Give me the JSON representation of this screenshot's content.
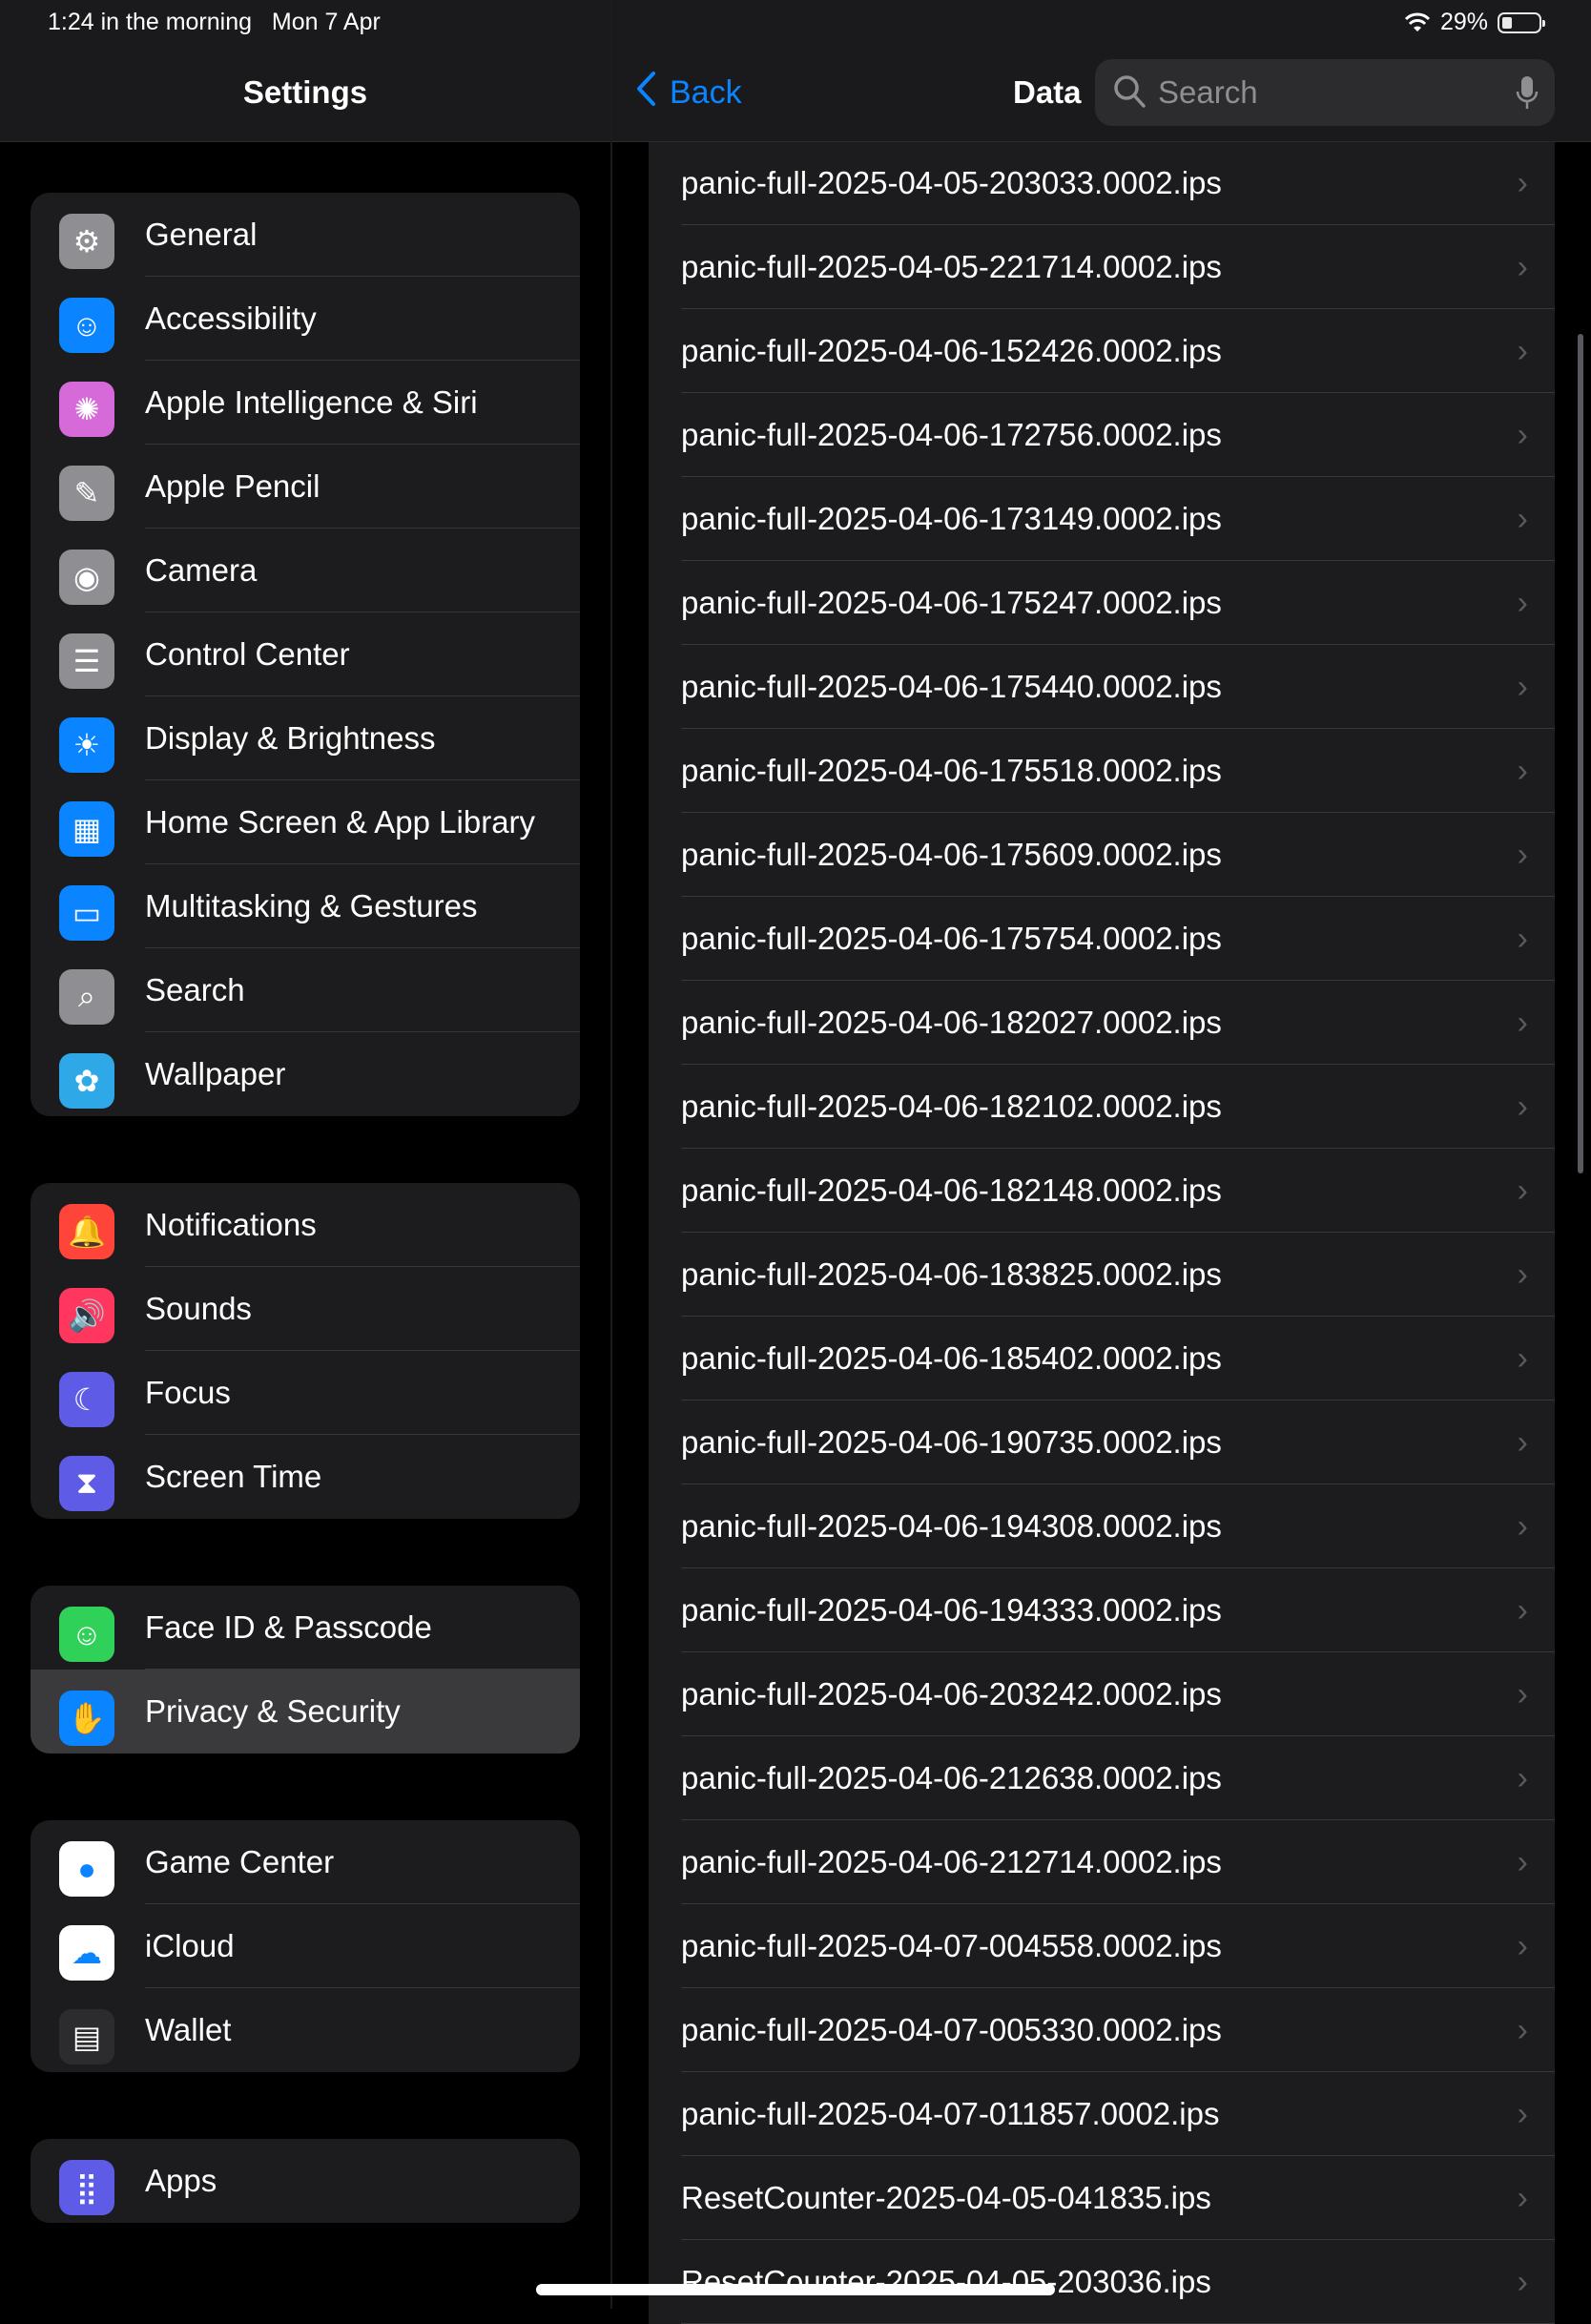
{
  "status_bar": {
    "time": "1:24 in the morning",
    "date": "Mon 7 Apr",
    "battery": "29%",
    "battery_level": 0.29
  },
  "sidebar": {
    "title": "Settings",
    "groups": [
      {
        "items": [
          {
            "label": "General",
            "icon": "gear-icon",
            "color": "#8e8e93"
          },
          {
            "label": "Accessibility",
            "icon": "accessibility-icon",
            "color": "#0a84ff"
          },
          {
            "label": "Apple Intelligence & Siri",
            "icon": "apple-intelligence-icon",
            "color": "#d66ad9"
          },
          {
            "label": "Apple Pencil",
            "icon": "pencil-icon",
            "color": "#8e8e93"
          },
          {
            "label": "Camera",
            "icon": "camera-icon",
            "color": "#8e8e93"
          },
          {
            "label": "Control Center",
            "icon": "toggles-icon",
            "color": "#8e8e93"
          },
          {
            "label": "Display & Brightness",
            "icon": "sun-icon",
            "color": "#0a84ff"
          },
          {
            "label": "Home Screen & App Library",
            "icon": "home-screen-icon",
            "color": "#0a84ff"
          },
          {
            "label": "Multitasking & Gestures",
            "icon": "multitasking-icon",
            "color": "#0a84ff"
          },
          {
            "label": "Search",
            "icon": "search-icon",
            "color": "#8e8e93"
          },
          {
            "label": "Wallpaper",
            "icon": "flower-icon",
            "color": "#2ea8e6"
          }
        ]
      },
      {
        "items": [
          {
            "label": "Notifications",
            "icon": "bell-icon",
            "color": "#ff453a"
          },
          {
            "label": "Sounds",
            "icon": "speaker-icon",
            "color": "#ff375f"
          },
          {
            "label": "Focus",
            "icon": "moon-icon",
            "color": "#5e5ce6"
          },
          {
            "label": "Screen Time",
            "icon": "hourglass-icon",
            "color": "#5e5ce6"
          }
        ]
      },
      {
        "items": [
          {
            "label": "Face ID & Passcode",
            "icon": "face-id-icon",
            "color": "#30d158"
          },
          {
            "label": "Privacy & Security",
            "icon": "hand-icon",
            "color": "#0a84ff",
            "selected": true
          }
        ]
      },
      {
        "items": [
          {
            "label": "Game Center",
            "icon": "game-center-icon",
            "color": "#ffffff"
          },
          {
            "label": "iCloud",
            "icon": "cloud-icon",
            "color": "#ffffff"
          },
          {
            "label": "Wallet",
            "icon": "wallet-icon",
            "color": "#2c2c2e"
          }
        ]
      },
      {
        "items": [
          {
            "label": "Apps",
            "icon": "apps-grid-icon",
            "color": "#5e5ce6"
          }
        ]
      }
    ]
  },
  "detail": {
    "back_label": "Back",
    "title": "Data",
    "search_placeholder": "Search",
    "files": [
      "panic-full-2025-04-05-203033.0002.ips",
      "panic-full-2025-04-05-221714.0002.ips",
      "panic-full-2025-04-06-152426.0002.ips",
      "panic-full-2025-04-06-172756.0002.ips",
      "panic-full-2025-04-06-173149.0002.ips",
      "panic-full-2025-04-06-175247.0002.ips",
      "panic-full-2025-04-06-175440.0002.ips",
      "panic-full-2025-04-06-175518.0002.ips",
      "panic-full-2025-04-06-175609.0002.ips",
      "panic-full-2025-04-06-175754.0002.ips",
      "panic-full-2025-04-06-182027.0002.ips",
      "panic-full-2025-04-06-182102.0002.ips",
      "panic-full-2025-04-06-182148.0002.ips",
      "panic-full-2025-04-06-183825.0002.ips",
      "panic-full-2025-04-06-185402.0002.ips",
      "panic-full-2025-04-06-190735.0002.ips",
      "panic-full-2025-04-06-194308.0002.ips",
      "panic-full-2025-04-06-194333.0002.ips",
      "panic-full-2025-04-06-203242.0002.ips",
      "panic-full-2025-04-06-212638.0002.ips",
      "panic-full-2025-04-06-212714.0002.ips",
      "panic-full-2025-04-07-004558.0002.ips",
      "panic-full-2025-04-07-005330.0002.ips",
      "panic-full-2025-04-07-011857.0002.ips",
      "ResetCounter-2025-04-05-041835.ips",
      "ResetCounter-2025-04-05-203036.ips"
    ]
  }
}
